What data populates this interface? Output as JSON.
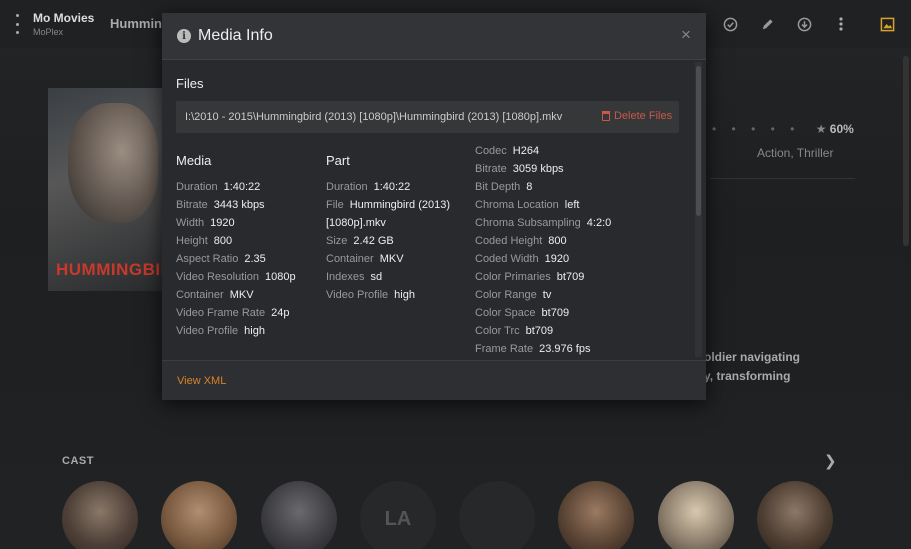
{
  "app": {
    "title": "Mo Movies",
    "subtitle": "MoPlex"
  },
  "background": {
    "heading": "Hummingbird",
    "poster_title": "HUMMINGBIRD",
    "rating_dots": "• • • • •",
    "rating_percent": "60%",
    "genres": "Action, Thriller",
    "summary_line1": "oldier navigating",
    "summary_line2": "y, transforming",
    "cast_label": "CAST",
    "cast_initials": "LA"
  },
  "icons": {
    "menu": "menu-dots-icon",
    "watched": "check-circle-icon",
    "edit": "pencil-icon",
    "download": "download-icon",
    "more": "more-vertical-icon",
    "image": "image-icon",
    "info": "info-icon",
    "close": "close-icon",
    "trash": "trash-icon",
    "next": "chevron-right-icon",
    "star": "star-icon"
  },
  "colors": {
    "accent": "#d9822b",
    "danger": "#c9584b",
    "poster_title": "#c8392b"
  },
  "modal": {
    "title": "Media Info",
    "close_label": "×",
    "info_glyph": "i",
    "files_label": "Files",
    "file_path": "I:\\2010 - 2015\\Hummingbird (2013) [1080p]\\Hummingbird (2013) [1080p].mkv",
    "delete_label": "Delete Files",
    "view_xml_label": "View XML",
    "media": {
      "heading": "Media",
      "rows": [
        {
          "k": "Duration",
          "v": "1:40:22"
        },
        {
          "k": "Bitrate",
          "v": "3443 kbps"
        },
        {
          "k": "Width",
          "v": "1920"
        },
        {
          "k": "Height",
          "v": "800"
        },
        {
          "k": "Aspect Ratio",
          "v": "2.35"
        },
        {
          "k": "Video Resolution",
          "v": "1080p"
        },
        {
          "k": "Container",
          "v": "MKV"
        },
        {
          "k": "Video Frame Rate",
          "v": "24p"
        },
        {
          "k": "Video Profile",
          "v": "high"
        }
      ]
    },
    "part": {
      "heading": "Part",
      "rows": [
        {
          "k": "Duration",
          "v": "1:40:22"
        },
        {
          "k": "File",
          "v": "Hummingbird (2013)"
        },
        {
          "k": "",
          "v": "[1080p].mkv"
        },
        {
          "k": "Size",
          "v": "2.42 GB"
        },
        {
          "k": "Container",
          "v": "MKV"
        },
        {
          "k": "Indexes",
          "v": "sd"
        },
        {
          "k": "Video Profile",
          "v": "high"
        }
      ]
    },
    "stream": {
      "rows": [
        {
          "k": "Codec",
          "v": "H264"
        },
        {
          "k": "Bitrate",
          "v": "3059 kbps"
        },
        {
          "k": "Bit Depth",
          "v": "8"
        },
        {
          "k": "Chroma Location",
          "v": "left"
        },
        {
          "k": "Chroma Subsampling",
          "v": "4:2:0"
        },
        {
          "k": "Coded Height",
          "v": "800"
        },
        {
          "k": "Coded Width",
          "v": "1920"
        },
        {
          "k": "Color Primaries",
          "v": "bt709"
        },
        {
          "k": "Color Range",
          "v": "tv"
        },
        {
          "k": "Color Space",
          "v": "bt709"
        },
        {
          "k": "Color Trc",
          "v": "bt709"
        },
        {
          "k": "Frame Rate",
          "v": "23.976 fps"
        }
      ]
    }
  }
}
